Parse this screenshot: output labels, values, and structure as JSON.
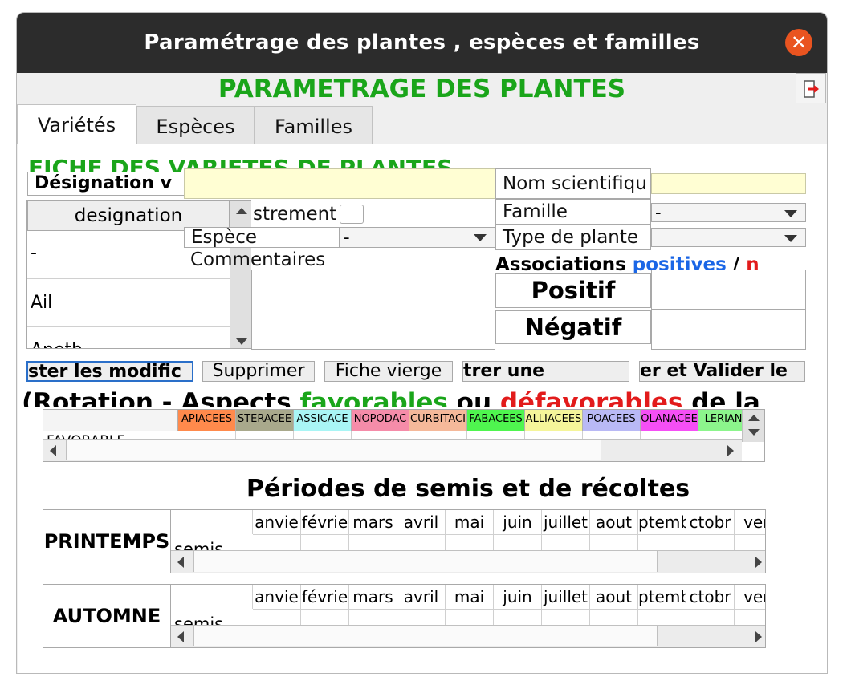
{
  "window": {
    "title": "Paramétrage des plantes , espèces et familles"
  },
  "header": {
    "title": "PARAMETRAGE DES PLANTES"
  },
  "tabs": [
    "Variétés",
    "Espèces",
    "Familles"
  ],
  "fiche": {
    "section_title": "FICHE DES VARIETES DE PLANTES",
    "designation_label": "Désignation v",
    "designation_value": "",
    "nom_scientifique_label": "Nom scientifiqu",
    "nom_scientifique_value": "",
    "list_header": "designation",
    "list_items": [
      "-",
      "Ail",
      "Aneth"
    ],
    "enregistrement_label": "strement",
    "famille_label": "Famille",
    "famille_value": "-",
    "espece_label": "Espèce",
    "espece_value": "-",
    "type_plante_label": "Type de plante",
    "type_plante_value": "",
    "commentaires_label": "Commentaires",
    "associations_label": "Associations",
    "associations_pos": "positives",
    "associations_sep": "/",
    "associations_neg": "n",
    "positif_label": "Positif",
    "negatif_label": "Négatif"
  },
  "buttons": {
    "modif": "ster les modific",
    "supprimer": "Supprimer",
    "fiche_vierge": "Fiche vierge",
    "enregistrer": "trer une",
    "valider": "er et Valider le"
  },
  "rotation": {
    "prefix": "(Rotation - Aspects ",
    "favorables": "favorables",
    "ou": " ou ",
    "defavorables": "défavorables",
    "suffix": " de la",
    "row_label": "FAVORABLE",
    "families": [
      {
        "name": "APIACEES",
        "color": "#ff8a4c"
      },
      {
        "name": "STERACEE",
        "color": "#a9a98c"
      },
      {
        "name": "ASSICACE",
        "color": "#a9f5f5"
      },
      {
        "name": "NOPODAC",
        "color": "#f58ca9"
      },
      {
        "name": "CURBITACI",
        "color": "#f5b99a"
      },
      {
        "name": "FABACEES",
        "color": "#4ff54f"
      },
      {
        "name": "ALLIACEES",
        "color": "#f5f59a"
      },
      {
        "name": "POACEES",
        "color": "#b9b9f5"
      },
      {
        "name": "OLANACEE",
        "color": "#f54ff5"
      },
      {
        "name": "LERIANA",
        "color": "#8cf58c"
      }
    ]
  },
  "periodes": {
    "title": "Périodes de semis et de récoltes",
    "months": [
      "anvie",
      "févrie",
      "mars",
      "avril",
      "mai",
      "juin",
      "juillet",
      "aout",
      "ptemb",
      "ctobr",
      "ven"
    ],
    "seasons": [
      {
        "name": "PRINTEMPS",
        "row": "semis"
      },
      {
        "name": "AUTOMNE",
        "row": "semis"
      }
    ]
  }
}
